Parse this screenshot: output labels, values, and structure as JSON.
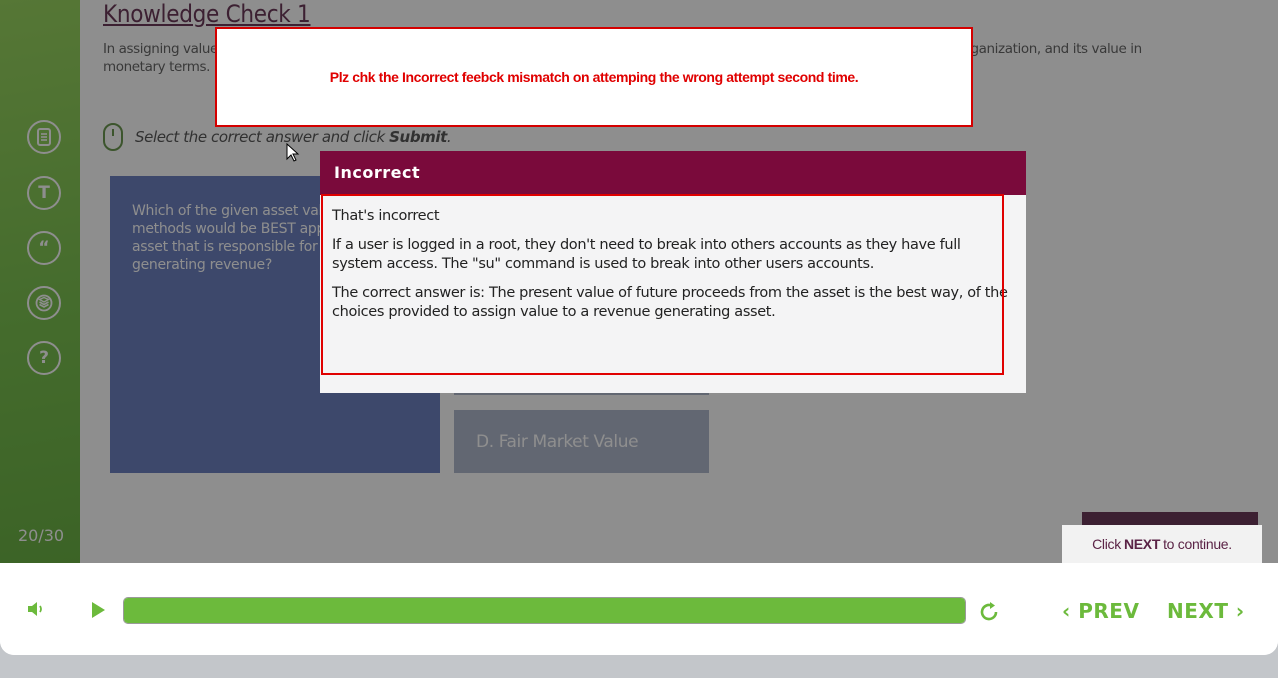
{
  "slide": {
    "title": "Knowledge Check 1",
    "intro": "In assigning value to an information asset, several factors need to be taken into consideration, including the asset type, its role in the organization, and its value in monetary terms. In a meeting between the firm's security manger and the firms head accountant regarding the valuation of assets...",
    "instruction_prefix": "Select the correct answer and click ",
    "instruction_bold": "Submit",
    "instruction_suffix": ".",
    "question": "Which of the given asset valuation methods would be BEST applied to an asset that is responsible for directly generating revenue?",
    "options": [
      {
        "label": ""
      },
      {
        "label": ""
      },
      {
        "label": ""
      },
      {
        "label": "D.  Fair Market Value"
      }
    ],
    "counter": "20/30",
    "next_hint_prefix": "Click ",
    "next_hint_bold": "NEXT",
    "next_hint_suffix": " to continue."
  },
  "sidebar": {
    "icons": [
      "document-icon",
      "text-icon",
      "quote-icon",
      "layers-icon",
      "help-icon"
    ]
  },
  "annotation": {
    "text": "Plz chk the Incorrect feebck mismatch on attemping the wrong attempt second time."
  },
  "modal": {
    "title": "Incorrect",
    "line1": "That's incorrect",
    "para1": "If a user is logged in a root, they don't need to break into others accounts as they have full system access. The \"su\" command is used to break into other users accounts.",
    "para2": "The correct answer is: The present value of future proceeds from the asset is the best way, of the choices provided to assign value to a revenue generating asset."
  },
  "controls": {
    "prev_label": "PREV",
    "next_label": "NEXT",
    "progress": 1.0,
    "accent_color": "#6cba3c"
  }
}
